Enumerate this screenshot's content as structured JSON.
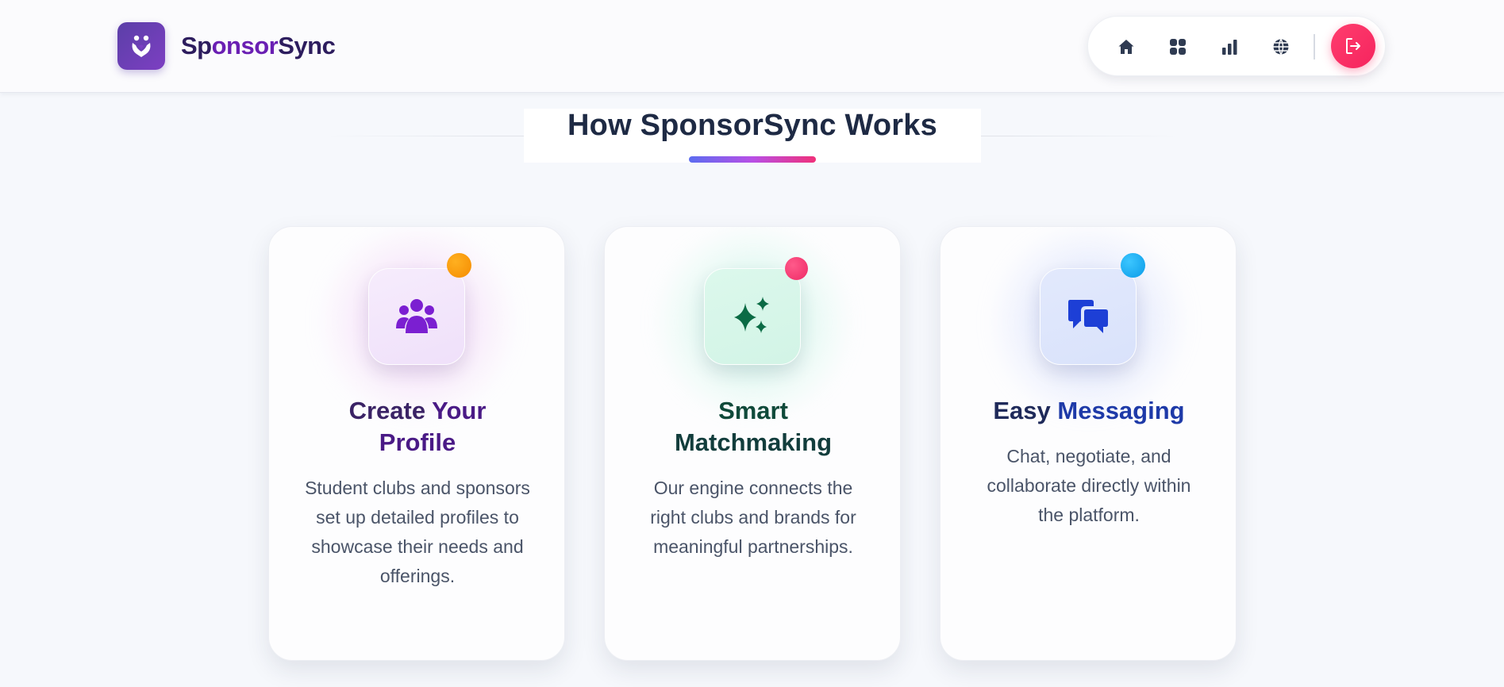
{
  "brand": {
    "name_part1": "Sp",
    "name_part2": "onsor",
    "name_part3": "Sync",
    "logo_icon": "handshake-heart-icon"
  },
  "nav": {
    "items": [
      {
        "icon": "home-icon"
      },
      {
        "icon": "dashboard-grid-icon"
      },
      {
        "icon": "bar-chart-icon"
      },
      {
        "icon": "globe-icon"
      }
    ],
    "logout_icon": "logout-icon"
  },
  "section": {
    "title": "How SponsorSync Works"
  },
  "cards": [
    {
      "title_a": "Create ",
      "title_b": "Your",
      "title_c": "Profile",
      "description": "Student clubs and sponsors set up detailed profiles to showcase their needs and offerings.",
      "icon": "users-group-icon",
      "accent": "#7b1fd1",
      "dot_color": "#ff9800"
    },
    {
      "title_a": "Smart",
      "title_b": "",
      "title_c": "Matchmaking",
      "description": "Our engine connects the right clubs and brands for meaningful partnerships.",
      "icon": "sparkles-icon",
      "accent": "#0b6b45",
      "dot_color": "#f5346e"
    },
    {
      "title_a": "Easy ",
      "title_b": "Messaging",
      "title_c": "",
      "description": "Chat, negotiate, and collaborate directly within the platform.",
      "icon": "chat-bubbles-icon",
      "accent": "#1d3fd6",
      "dot_color": "#0aa5f0"
    }
  ]
}
